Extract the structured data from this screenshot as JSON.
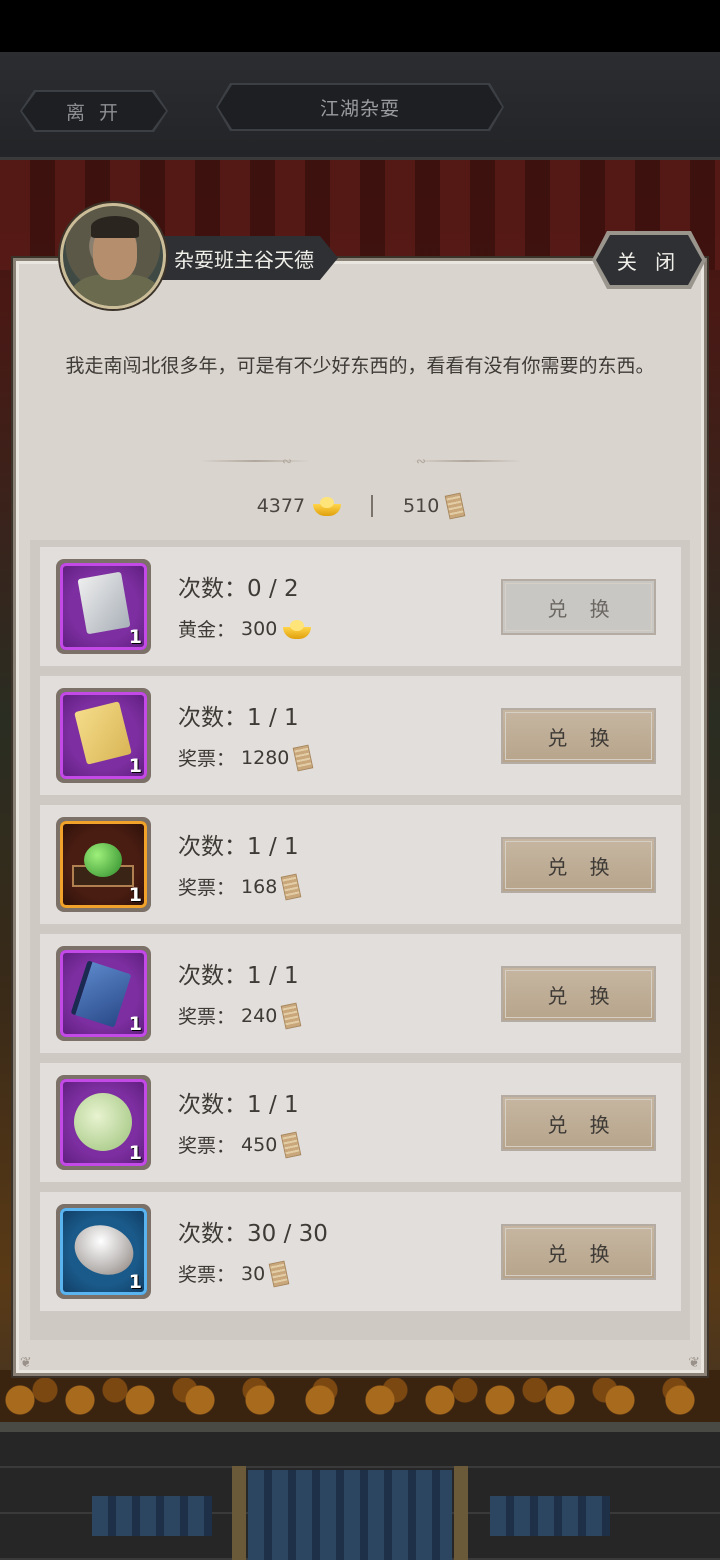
{
  "topbar": {
    "leave_label": "离 开",
    "title": "江湖杂耍"
  },
  "npc": {
    "name": "杂耍班主谷天德",
    "dialog": "我走南闯北很多年，可是有不少好东西的，看看有没有你需要的东西。"
  },
  "close_label": "关 闭",
  "currency": {
    "gold": "4377",
    "tickets": "510"
  },
  "rows": [
    {
      "count_label": "次数：",
      "count": "0 / 2",
      "price_label": "黄金：",
      "price": "300",
      "price_icon": "gold-ingot-icon",
      "qty": "1",
      "button": "兑 换",
      "button_enabled": false,
      "rarity": "purple",
      "item_icon": "silver-scroll-icon"
    },
    {
      "count_label": "次数：",
      "count": "1 / 1",
      "price_label": "奖票：",
      "price": "1280",
      "price_icon": "ticket-icon",
      "qty": "1",
      "button": "兑 换",
      "button_enabled": true,
      "rarity": "purple",
      "item_icon": "yellow-scroll-icon"
    },
    {
      "count_label": "次数：",
      "count": "1 / 1",
      "price_label": "奖票：",
      "price": "168",
      "price_icon": "ticket-icon",
      "qty": "1",
      "button": "兑 换",
      "button_enabled": true,
      "rarity": "orange",
      "item_icon": "jade-orb-icon"
    },
    {
      "count_label": "次数：",
      "count": "1 / 1",
      "price_label": "奖票：",
      "price": "240",
      "price_icon": "ticket-icon",
      "qty": "1",
      "button": "兑 换",
      "button_enabled": true,
      "rarity": "purple",
      "item_icon": "blue-book-icon"
    },
    {
      "count_label": "次数：",
      "count": "1 / 1",
      "price_label": "奖票：",
      "price": "450",
      "price_icon": "ticket-icon",
      "qty": "1",
      "button": "兑 换",
      "button_enabled": true,
      "rarity": "purple",
      "item_icon": "jade-disc-icon"
    },
    {
      "count_label": "次数：",
      "count": "30 / 30",
      "price_label": "奖票：",
      "price": "30",
      "price_icon": "ticket-icon",
      "qty": "1",
      "button": "兑 换",
      "button_enabled": true,
      "rarity": "blue",
      "item_icon": "pearl-icon"
    }
  ],
  "colors": {
    "panel": "#d9d4ce",
    "row": "#e2dedb",
    "button_active": "#c0ae96",
    "button_disabled": "#c9c7c4",
    "purple_rarity": "#c34ae6",
    "orange_rarity": "#f0a22a",
    "blue_rarity": "#5ab4f0"
  }
}
